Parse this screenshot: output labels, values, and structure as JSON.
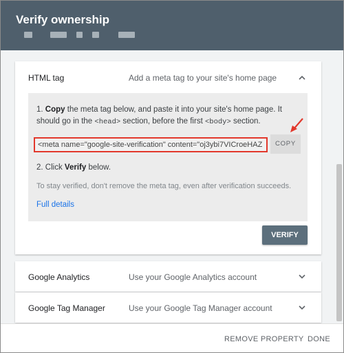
{
  "dialog": {
    "title": "Verify ownership"
  },
  "html_tag": {
    "title": "HTML tag",
    "description": "Add a meta tag to your site's home page",
    "step1_num": "1.",
    "step1_copy": "Copy",
    "step1_a": "the meta tag below, and paste it into your site's home page. It should go in the",
    "step1_head": "<head>",
    "step1_b": "section, before the first",
    "step1_body": "<body>",
    "step1_c": "section.",
    "meta_tag": "<meta name=\"google-site-verification\" content=\"oj3ybi7VICroeHAZ",
    "copy_label": "COPY",
    "step2_a": "2. Click",
    "step2_verify": "Verify",
    "step2_b": "below.",
    "note": "To stay verified, don't remove the meta tag, even after verification succeeds.",
    "full_details": "Full details",
    "verify_label": "VERIFY"
  },
  "google_analytics": {
    "title": "Google Analytics",
    "description": "Use your Google Analytics account"
  },
  "google_tag_manager": {
    "title": "Google Tag Manager",
    "description": "Use your Google Tag Manager account"
  },
  "footer": {
    "remove_label": "REMOVE PROPERTY",
    "done_label": "DONE"
  },
  "colors": {
    "header": "#4f5f6c",
    "highlight": "#e2382c",
    "link": "#1a73e8",
    "verify_button": "#5c6f7c"
  }
}
